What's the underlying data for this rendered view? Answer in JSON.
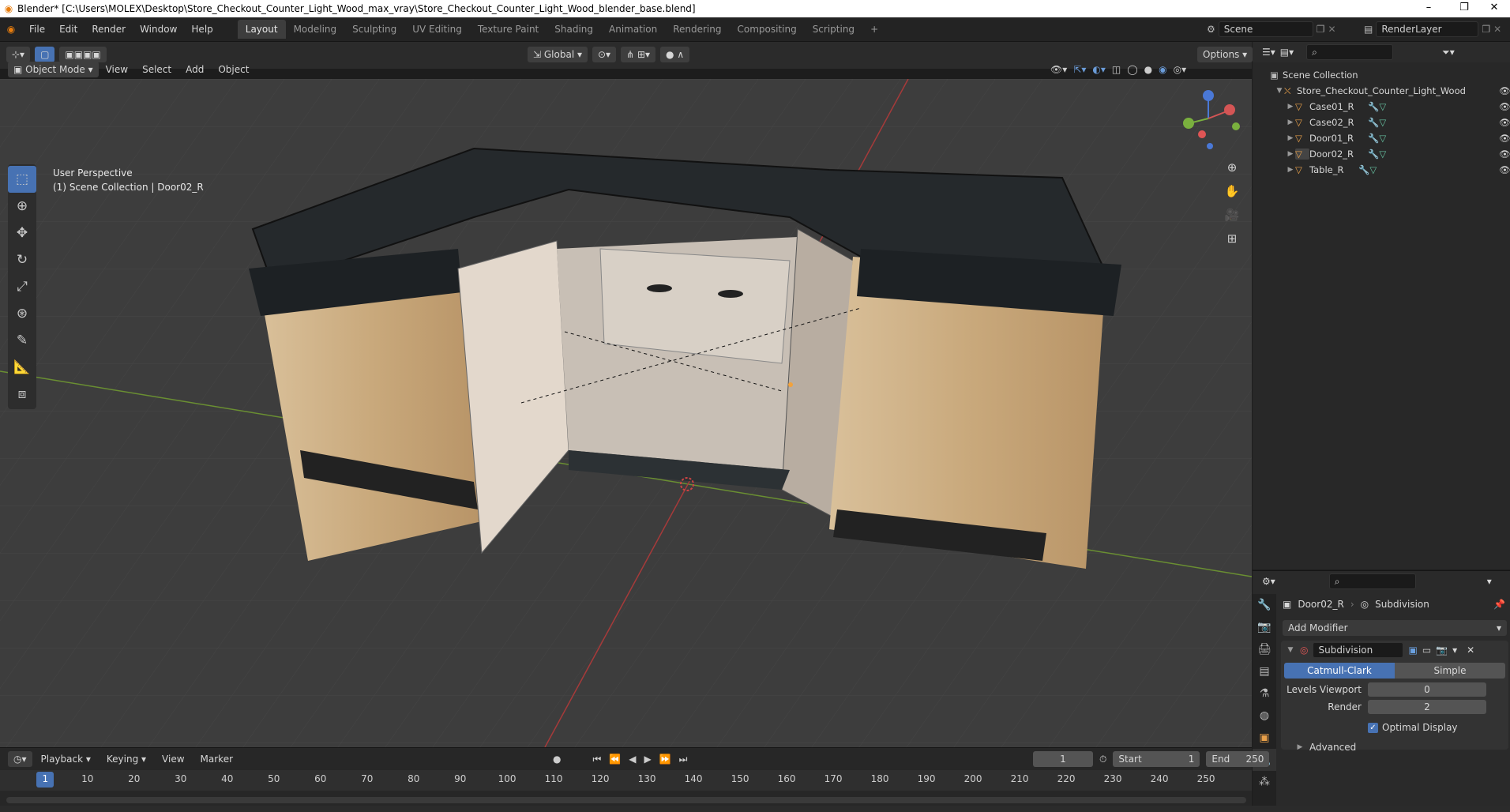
{
  "window": {
    "title": "Blender* [C:\\Users\\MOLEX\\Desktop\\Store_Checkout_Counter_Light_Wood_max_vray\\Store_Checkout_Counter_Light_Wood_blender_base.blend]",
    "minimize": "–",
    "maximize": "❐",
    "close": "✕"
  },
  "menu": [
    "File",
    "Edit",
    "Render",
    "Window",
    "Help"
  ],
  "workspaces": [
    "Layout",
    "Modeling",
    "Sculpting",
    "UV Editing",
    "Texture Paint",
    "Shading",
    "Animation",
    "Rendering",
    "Compositing",
    "Scripting"
  ],
  "scene": {
    "label": "Scene",
    "render_layer": "RenderLayer"
  },
  "viewport": {
    "mode": "Object Mode",
    "menu": [
      "View",
      "Select",
      "Add",
      "Object"
    ],
    "transform_orientation": "Global",
    "options": "Options",
    "perspective": "User Perspective",
    "collection_info": "(1) Scene Collection | Door02_R"
  },
  "outliner": {
    "root": "Scene Collection",
    "collection": "Store_Checkout_Counter_Light_Wood",
    "objects": [
      "Case01_R",
      "Case02_R",
      "Door01_R",
      "Door02_R",
      "Table_R"
    ]
  },
  "properties": {
    "object": "Door02_R",
    "modifier_breadcrumb": "Subdivision",
    "add_modifier": "Add Modifier",
    "modifier_name": "Subdivision",
    "catmull": "Catmull-Clark",
    "simple": "Simple",
    "levels_viewport_label": "Levels Viewport",
    "levels_viewport": "0",
    "render_label": "Render",
    "render_value": "2",
    "optimal_display": "Optimal Display",
    "advanced": "Advanced"
  },
  "timeline": {
    "menu": [
      "Playback",
      "Keying",
      "View",
      "Marker"
    ],
    "current_frame": "1",
    "start_label": "Start",
    "start": "1",
    "end_label": "End",
    "end": "250",
    "ticks": [
      "1",
      "10",
      "20",
      "30",
      "40",
      "50",
      "60",
      "70",
      "80",
      "90",
      "100",
      "110",
      "120",
      "130",
      "140",
      "150",
      "160",
      "170",
      "180",
      "190",
      "200",
      "210",
      "220",
      "230",
      "240",
      "250"
    ]
  }
}
